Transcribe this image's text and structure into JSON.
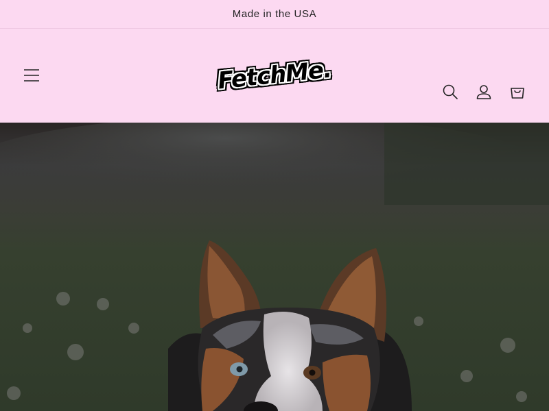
{
  "announcement": {
    "text": "Made in the USA"
  },
  "header": {
    "logo_text": "FetchMe.",
    "icons": {
      "menu": "hamburger-menu-icon",
      "search": "search-icon",
      "account": "account-icon",
      "cart": "cart-icon"
    }
  },
  "colors": {
    "background": "#fcd9f1",
    "text": "#222222",
    "hero_overlay": "#2e3226"
  },
  "hero": {
    "image_subject": "corgi dog in a grassy field"
  }
}
